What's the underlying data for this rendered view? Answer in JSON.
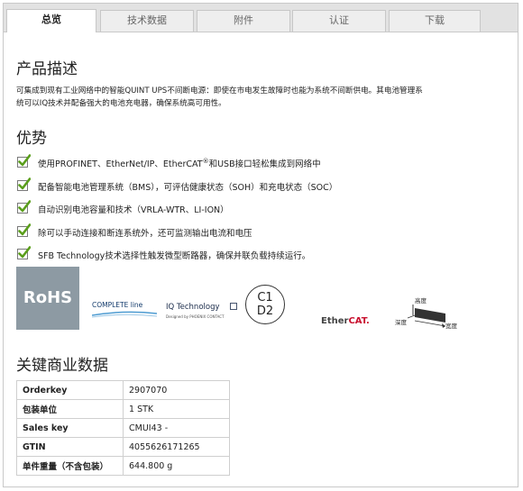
{
  "tabs": [
    {
      "label": "总览",
      "active": true
    },
    {
      "label": "技术数据",
      "active": false
    },
    {
      "label": "附件",
      "active": false
    },
    {
      "label": "认证",
      "active": false
    },
    {
      "label": "下载",
      "active": false
    }
  ],
  "description": {
    "heading": "产品描述",
    "text_line1": "可集成到现有工业网络中的智能QUINT UPS不间断电源：即使在市电发生故障时也能为系统不间断供电。其电池管理系",
    "text_line2": "统可以IQ技术并配备强大的电池充电器，确保系统高可用性。"
  },
  "benefits": {
    "heading": "优势",
    "items": [
      {
        "text": "使用PROFINET、EtherNet/IP、EtherCAT",
        "sup": "®",
        "tail": "和USB接口轻松集成到网络中"
      },
      {
        "text": "配备智能电池管理系统（BMS），可评估健康状态（SOH）和充电状态（SOC）",
        "sup": "",
        "tail": ""
      },
      {
        "text": "自动识别电池容量和技术（VRLA-WTR、LI-ION）",
        "sup": "",
        "tail": ""
      },
      {
        "text": "除可以手动连接和断连系统外，还可监测输出电流和电压",
        "sup": "",
        "tail": ""
      },
      {
        "text": "SFB Technology技术选择性触发微型断路器，确保并联负载持续运行。",
        "sup": "",
        "tail": ""
      }
    ]
  },
  "logos": {
    "rohs": "RoHS",
    "complete_line": "COMPLETE line",
    "iq_tech": "IQ Technology",
    "iq_sub": "Designed by PHOENIX CONTACT",
    "c1": "C1",
    "d2": "D2",
    "ethercat_a": "Ether",
    "ethercat_b": "CAT.",
    "height_label": "高度",
    "depth_label": "深度",
    "width_label": "宽度"
  },
  "commercial": {
    "heading": "关键商业数据",
    "rows": [
      {
        "key": "Orderkey",
        "value": "2907070"
      },
      {
        "key": "包装单位",
        "value": "1 STK"
      },
      {
        "key": "Sales key",
        "value": "CMUI43 -"
      },
      {
        "key": "GTIN",
        "value": "4055626171265"
      },
      {
        "key": "单件重量（不含包装）",
        "value": "644.800 g"
      }
    ]
  },
  "colors": {
    "check_green": "#5a9e1b",
    "rohs_bg": "#8d9aa3",
    "ethercat_red": "#c8102e"
  }
}
